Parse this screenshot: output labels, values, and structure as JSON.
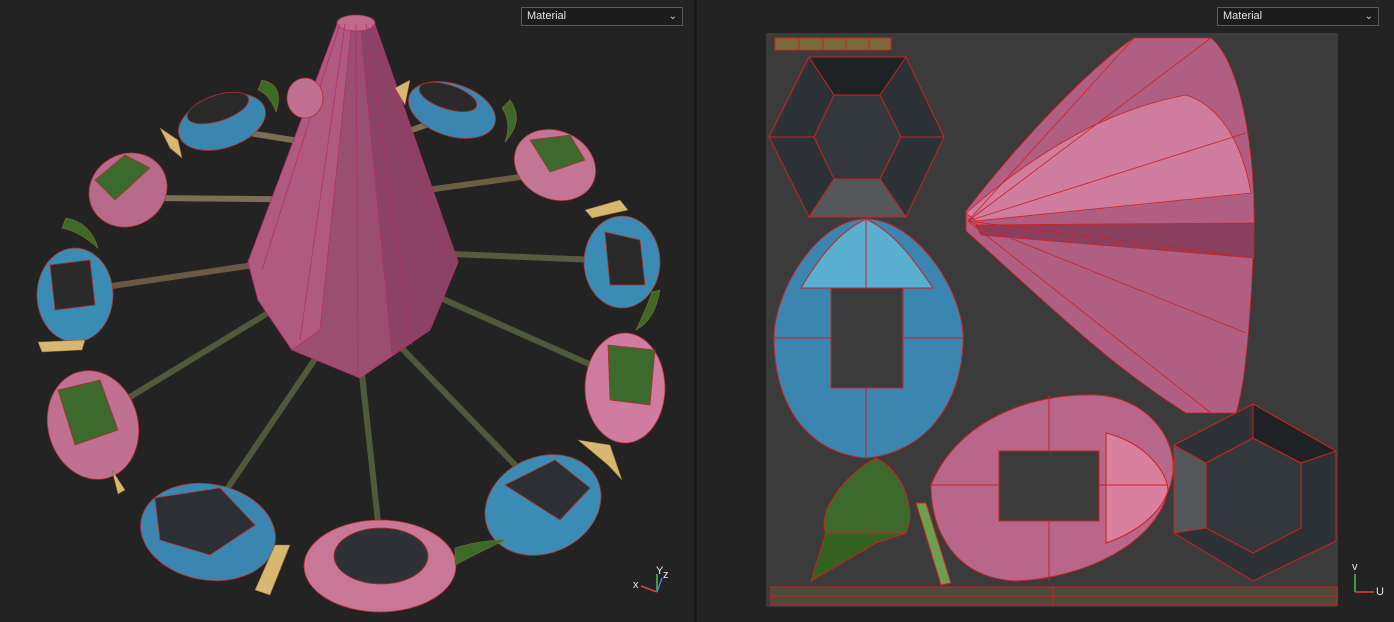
{
  "viewports": {
    "left": {
      "shading_mode": "Material",
      "axes": {
        "x": "x",
        "y": "Y",
        "z": "z"
      }
    },
    "right": {
      "shading_mode": "Material",
      "axes": {
        "v": "v",
        "u": "U"
      }
    }
  },
  "colors": {
    "background": "#232323",
    "uv_sheet": "#3b3b3b",
    "pink": "#c87896",
    "dark_pink": "#8a4866",
    "blue": "#3a8cb4",
    "green": "#3c6a2c",
    "wood": "#7a6a48",
    "edge": "#cc2222"
  },
  "icons": {
    "dropdown": "chevron-down-icon",
    "axis_gizmo": "axis-gizmo-icon"
  }
}
